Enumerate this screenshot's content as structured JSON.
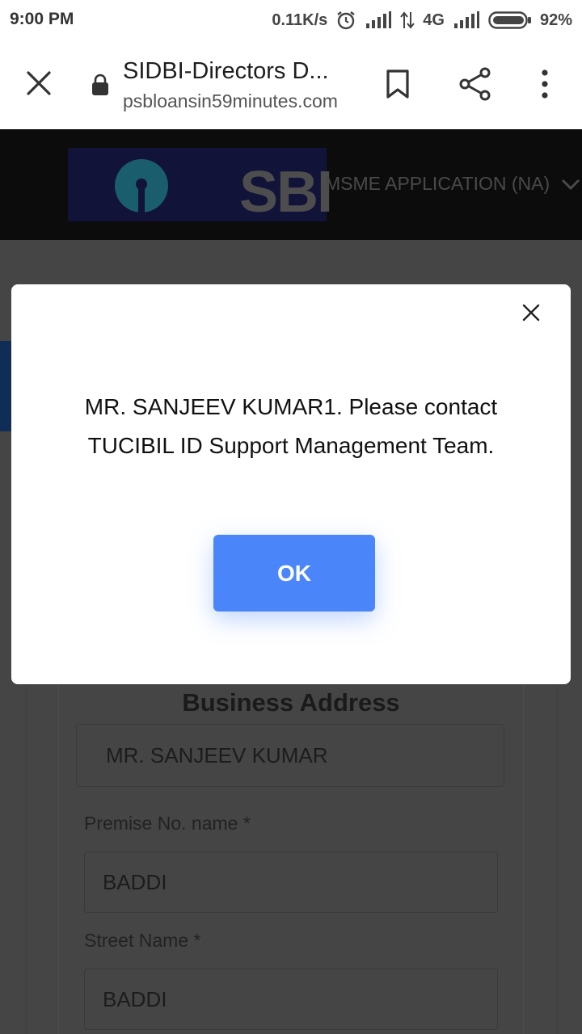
{
  "status_bar": {
    "time": "9:00 PM",
    "network_speed": "0.11K/s",
    "network_type": "4G",
    "battery": "92%"
  },
  "browser": {
    "tab_title": "SIDBI-Directors D...",
    "url": "psbloansin59minutes.com",
    "icons": [
      "close-icon",
      "lock-icon",
      "bookmark-icon",
      "share-icon",
      "more-vert-icon"
    ]
  },
  "site": {
    "logo_text": "SBI",
    "nav_label": "MSME APPLICATION (NA)"
  },
  "form": {
    "section_title": "Business Address",
    "name_value": "MR. SANJEEV KUMAR",
    "premise_label": "Premise No. name *",
    "premise_value": "BADDI",
    "street_label": "Street Name *",
    "street_value": "BADDI"
  },
  "dialog": {
    "message": "MR. SANJEEV KUMAR1. Please contact TUCIBIL ID Support Management Team.",
    "ok_label": "OK"
  },
  "colors": {
    "ok_button": "#4a86fa",
    "overlay_page": "#454545",
    "site_header": "#0c0c0c"
  }
}
